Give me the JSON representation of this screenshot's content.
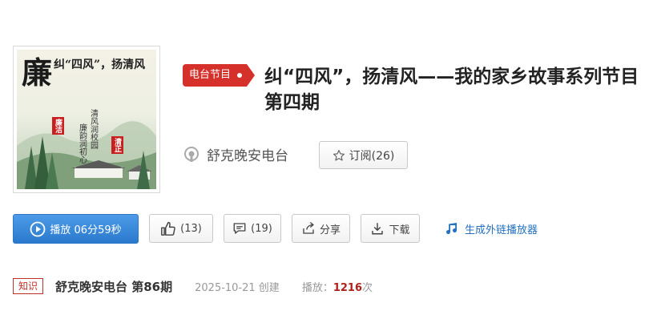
{
  "cover": {
    "big_char": "廉",
    "title": "纠“四风”，扬清风",
    "seal_1": "廉洁",
    "seal_2": "清正",
    "poem_1": "清风润校园",
    "poem_2": "廉韵润初心"
  },
  "tag": "电台节目",
  "title": "纠“四风”，扬清风——我的家乡故事系列节目第四期",
  "station_name": "舒克晚安电台",
  "subscribe_label": "订阅(26)",
  "actions": {
    "play_label": "播放 06分59秒",
    "like_label": "(13)",
    "comment_label": "(19)",
    "share_label": "分享",
    "download_label": "下载",
    "gen_player_label": "生成外链播放器"
  },
  "meta": {
    "category": "知识",
    "episode": "舒克晚安电台  第86期",
    "created": "2025-10-21 创建",
    "plays_prefix": "播放：",
    "plays_count": "1216",
    "plays_suffix": "次"
  },
  "colors": {
    "tag_red": "#d5312a",
    "play_blue": "#2a79cd",
    "link_blue": "#2371c0",
    "plays_red": "#b0201b"
  }
}
